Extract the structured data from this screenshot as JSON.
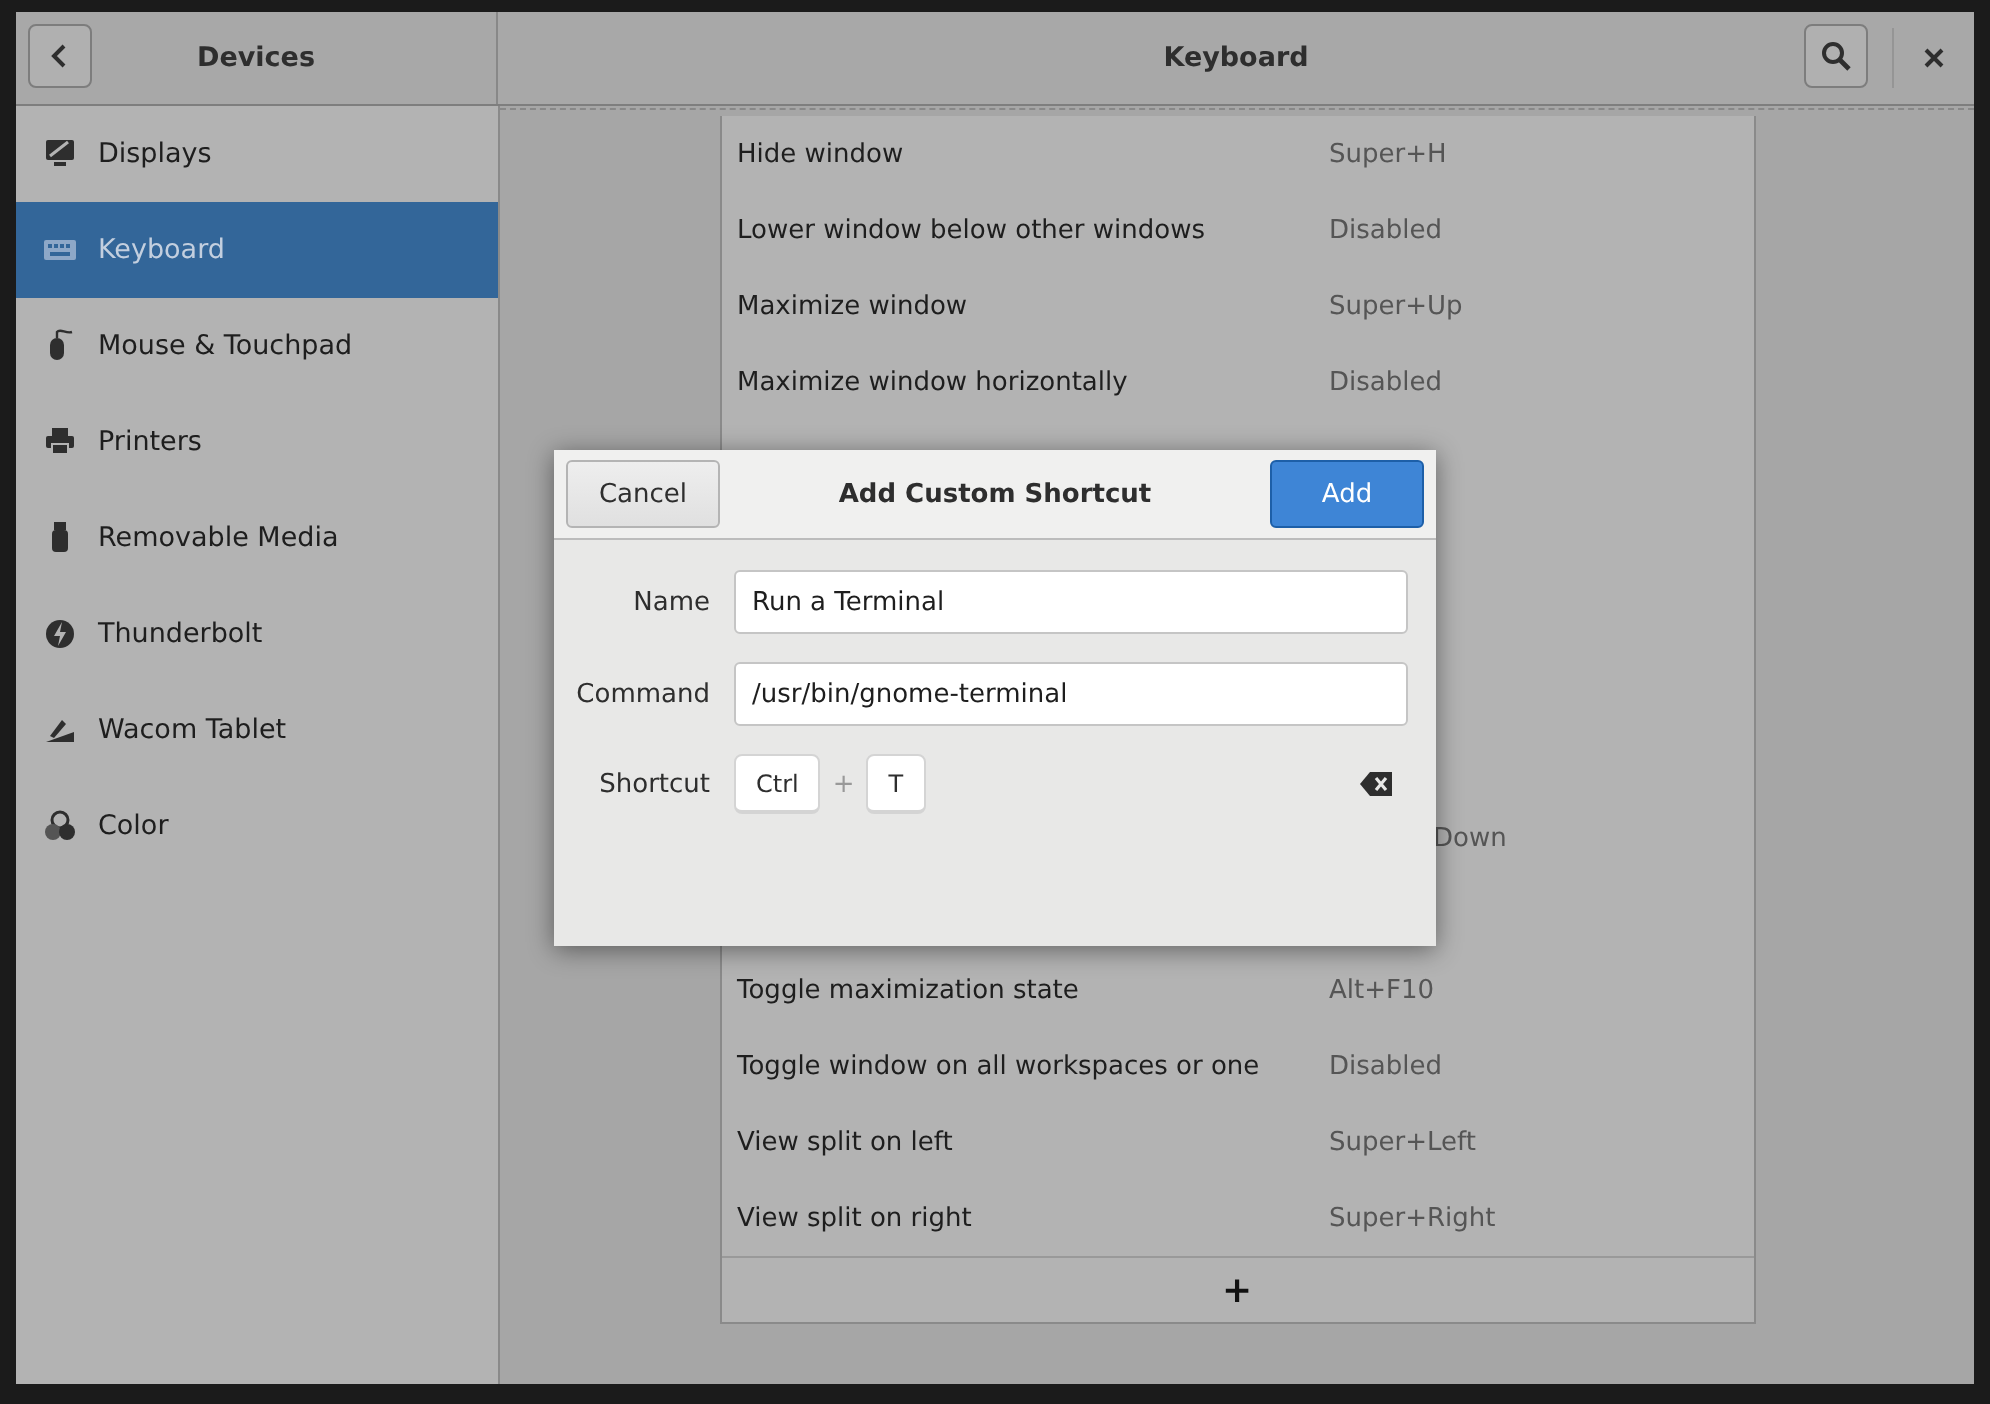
{
  "header": {
    "sidebar_title": "Devices",
    "panel_title": "Keyboard"
  },
  "sidebar": {
    "items": [
      {
        "label": "Displays",
        "selected": false
      },
      {
        "label": "Keyboard",
        "selected": true
      },
      {
        "label": "Mouse & Touchpad",
        "selected": false
      },
      {
        "label": "Printers",
        "selected": false
      },
      {
        "label": "Removable Media",
        "selected": false
      },
      {
        "label": "Thunderbolt",
        "selected": false
      },
      {
        "label": "Wacom Tablet",
        "selected": false
      },
      {
        "label": "Color",
        "selected": false
      }
    ]
  },
  "shortcuts": {
    "rows": [
      {
        "kind": "shortcut",
        "name": "Hide window",
        "accel": "Super+H"
      },
      {
        "kind": "shortcut",
        "name": "Lower window below other windows",
        "accel": "Disabled"
      },
      {
        "kind": "shortcut",
        "name": "Maximize window",
        "accel": "Super+Up"
      },
      {
        "kind": "shortcut",
        "name": "Maximize window horizontally",
        "accel": "Disabled"
      },
      {
        "kind": "covered"
      },
      {
        "kind": "covered"
      },
      {
        "kind": "covered"
      },
      {
        "kind": "covered"
      },
      {
        "kind": "covered"
      },
      {
        "kind": "tail",
        "accel": "Down"
      },
      {
        "kind": "covered"
      },
      {
        "kind": "shortcut",
        "name": "Toggle maximization state",
        "accel": "Alt+F10"
      },
      {
        "kind": "shortcut",
        "name": "Toggle window on all workspaces or one",
        "accel": "Disabled"
      },
      {
        "kind": "shortcut",
        "name": "View split on left",
        "accel": "Super+Left"
      },
      {
        "kind": "shortcut",
        "name": "View split on right",
        "accel": "Super+Right"
      }
    ],
    "add_label": "+"
  },
  "dialog": {
    "title": "Add Custom Shortcut",
    "cancel": "Cancel",
    "confirm": "Add",
    "fields": [
      {
        "label": "Name",
        "value": "Run a Terminal"
      },
      {
        "label": "Command",
        "value": "/usr/bin/gnome-terminal"
      }
    ],
    "shortcut": {
      "label": "Shortcut",
      "keys": [
        "Ctrl",
        "T"
      ],
      "separator": "+"
    }
  }
}
